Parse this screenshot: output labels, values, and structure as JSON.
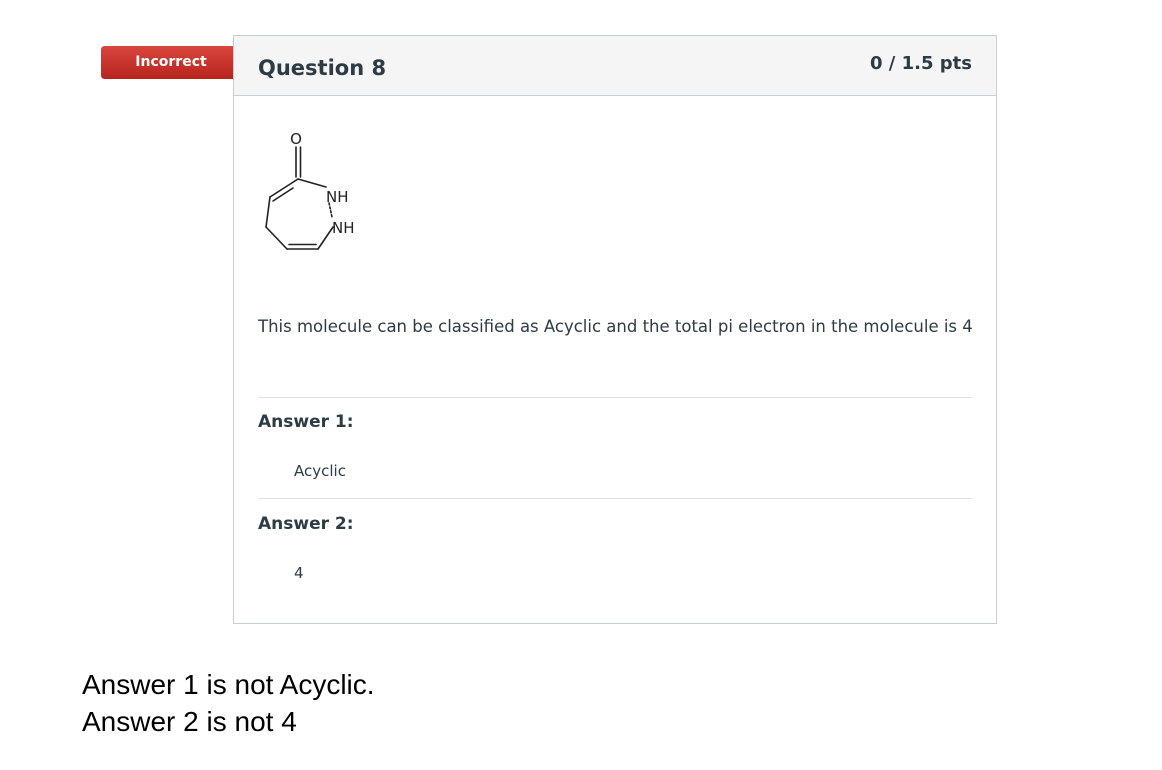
{
  "status": {
    "label": "Incorrect",
    "color": "#c8302a"
  },
  "question": {
    "title": "Question 8",
    "points": "0 / 1.5 pts",
    "molecule_labels": {
      "oxygen": "O",
      "nh_top": "NH",
      "nh_bottom": "NH"
    },
    "text": "This molecule can be classified as Acyclic and the total pi electron in the molecule is 4"
  },
  "answers": [
    {
      "label": "Answer 1:",
      "value": "Acyclic"
    },
    {
      "label": "Answer 2:",
      "value": "4"
    }
  ],
  "notes": [
    "Answer 1 is not Acyclic.",
    "Answer 2 is not 4"
  ]
}
